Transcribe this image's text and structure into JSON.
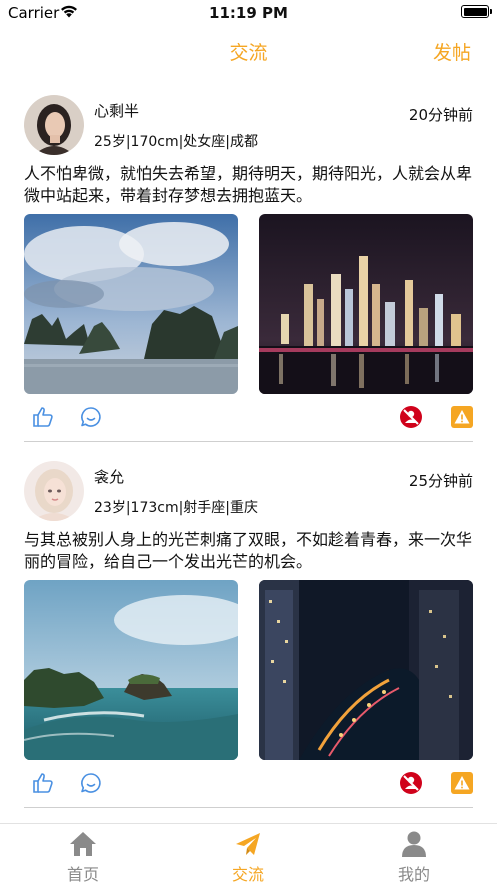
{
  "status_bar": {
    "carrier": "Carrier",
    "time": "11:19 PM"
  },
  "nav": {
    "title": "交流",
    "post_button": "发帖"
  },
  "colors": {
    "accent": "#f5a623",
    "blue_icon": "#4a90e2",
    "block_red": "#d0021b",
    "warning_orange": "#f5a623",
    "tab_inactive": "#8a8a8a"
  },
  "posts": [
    {
      "name": "心剩半",
      "time": "20分钟前",
      "info": "25岁|170cm|处女座|成都",
      "content": "人不怕卑微，就怕失去希望，期待明天，期待阳光，人就会从卑微中站起来，带着封存梦想去拥抱蓝天。",
      "photos": [
        "karst-islands-sea-cloudy-sky",
        "city-skyline-night-reflection"
      ]
    },
    {
      "name": "衾允",
      "time": "25分钟前",
      "info": "23岁|173cm|射手座|重庆",
      "content": "与其总被别人身上的光芒刺痛了双眼，不如趁着青春，来一次华丽的冒险，给自己一个发出光芒的机会。",
      "photos": [
        "rocky-islet-ocean-coast",
        "city-marina-night-aerial"
      ]
    }
  ],
  "icons": {
    "like": "thumbs-up-icon",
    "comment": "comment-bubble-icon",
    "block": "block-user-icon",
    "report": "warning-icon"
  },
  "tabs": [
    {
      "label": "首页",
      "icon": "home-icon",
      "active": false
    },
    {
      "label": "交流",
      "icon": "paper-plane-icon",
      "active": true
    },
    {
      "label": "我的",
      "icon": "person-icon",
      "active": false
    }
  ]
}
